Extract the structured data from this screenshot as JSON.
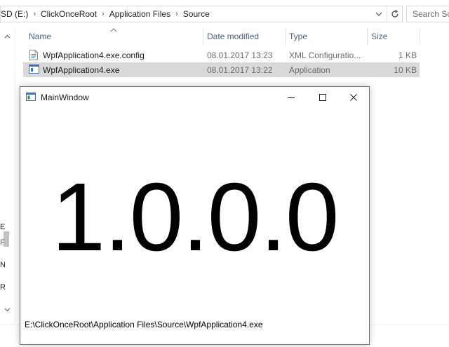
{
  "explorer": {
    "breadcrumbs": [
      "SD (E:)",
      "ClickOnceRoot",
      "Application Files",
      "Source"
    ],
    "search_placeholder": "Search Source",
    "columns": {
      "name": "Name",
      "date": "Date modified",
      "type": "Type",
      "size": "Size"
    },
    "files": [
      {
        "name": "WpfApplication4.exe.config",
        "date": "08.01.2017 13:23",
        "type": "XML Configuratio...",
        "size": "1 KB",
        "icon": "config-file-icon",
        "selected": false
      },
      {
        "name": "WpfApplication4.exe",
        "date": "08.01.2017 13:22",
        "type": "Application",
        "size": "10 KB",
        "icon": "application-icon",
        "selected": true
      }
    ],
    "nav_fragments": [
      "E",
      "F",
      "N",
      "R"
    ],
    "colors": {
      "selection": "#d9d9d9",
      "header_text": "#4c607a",
      "nav_link": "#1979ca"
    }
  },
  "window": {
    "title": "MainWindow",
    "version": "1.0.0.0",
    "exe_path": "E:\\ClickOnceRoot\\Application Files\\Source\\WpfApplication4.exe"
  }
}
